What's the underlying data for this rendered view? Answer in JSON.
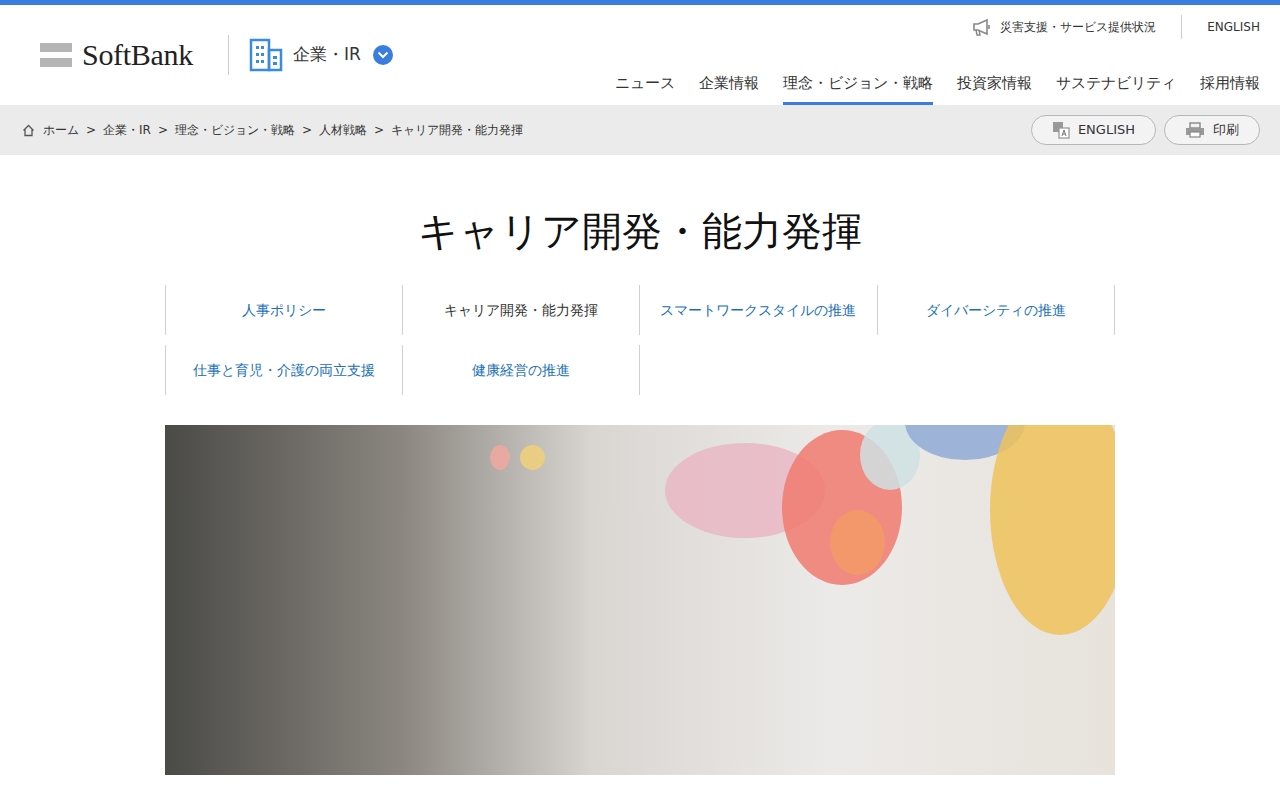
{
  "logo": "SoftBank",
  "section": "企業・IR",
  "utility_links": [
    "災害支援・サービス提供状況",
    "ENGLISH"
  ],
  "nav": [
    {
      "label": "ニュース",
      "selected": false
    },
    {
      "label": "企業情報",
      "selected": false
    },
    {
      "label": "理念・ビジョン・戦略",
      "selected": true
    },
    {
      "label": "投資家情報",
      "selected": false
    },
    {
      "label": "サステナビリティ",
      "selected": false
    },
    {
      "label": "採用情報",
      "selected": false
    }
  ],
  "breadcrumb": {
    "separator": ">",
    "items": [
      "ホーム",
      "企業・IR",
      "理念・ビジョン・戦略",
      "人材戦略",
      "キャリア開発・能力発揮"
    ]
  },
  "page_actions": [
    "ENGLISH",
    "印刷"
  ],
  "title": "キャリア開発・能力発揮",
  "subnav": [
    {
      "label": "人事ポリシー",
      "selected": false
    },
    {
      "label": "キャリア開発・能力発揮",
      "selected": true
    },
    {
      "label": "スマートワークスタイルの推進",
      "selected": false
    },
    {
      "label": "ダイバーシティの推進",
      "selected": false
    },
    {
      "label": "仕事と育児・介護の両立支援",
      "selected": false
    },
    {
      "label": "健康経営の推進",
      "selected": false
    }
  ]
}
